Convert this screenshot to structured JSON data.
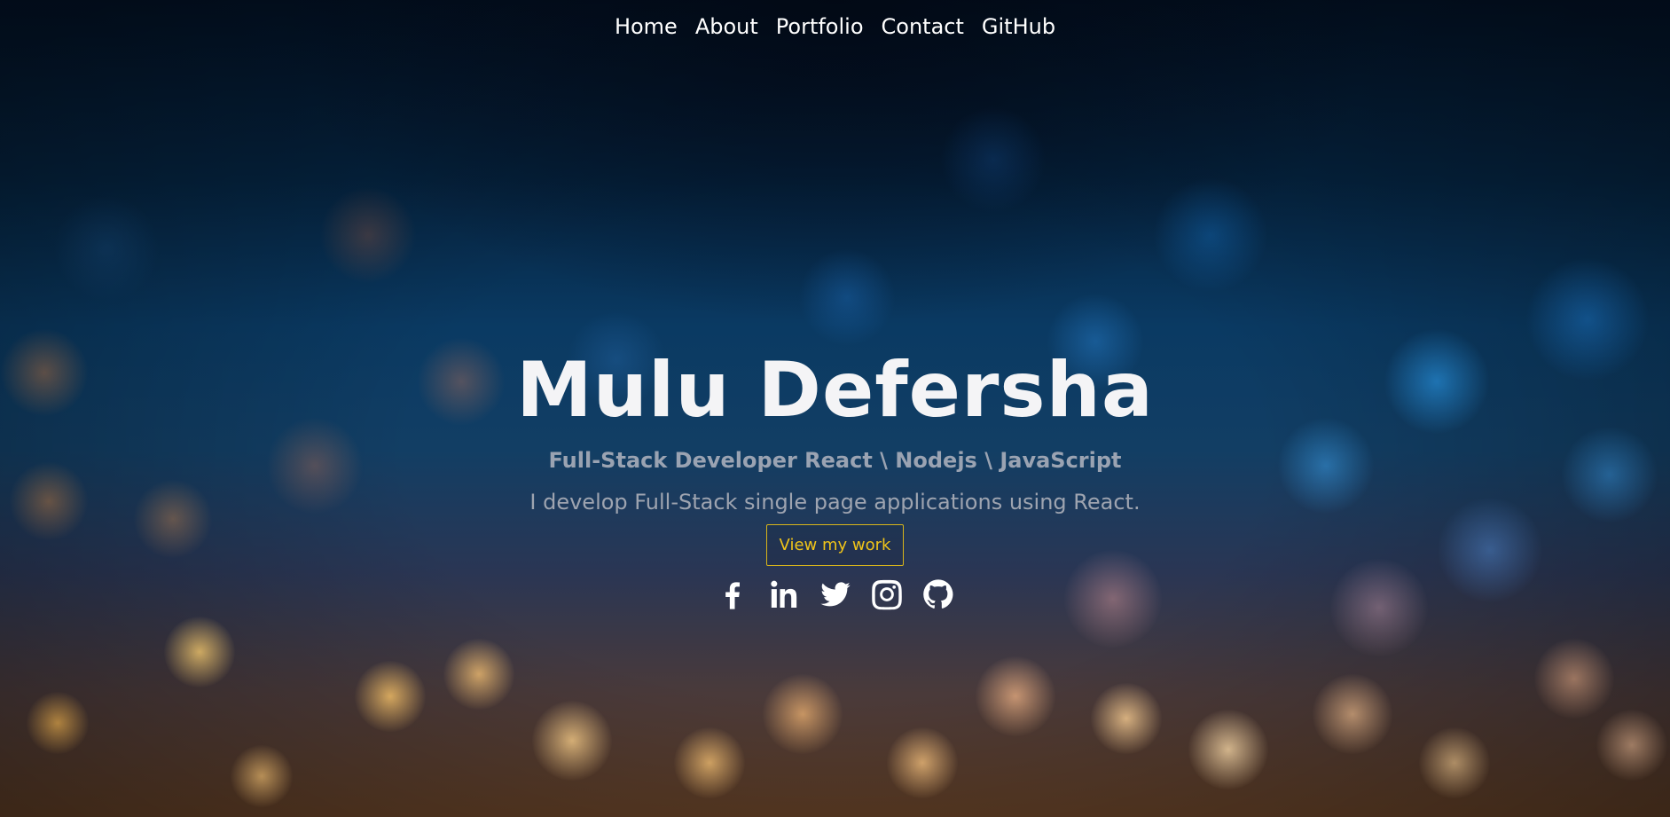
{
  "nav": {
    "items": [
      {
        "label": "Home"
      },
      {
        "label": "About"
      },
      {
        "label": "Portfolio"
      },
      {
        "label": "Contact"
      },
      {
        "label": "GitHub"
      }
    ]
  },
  "hero": {
    "name": "Mulu Defersha",
    "subtitle": "Full-Stack Developer React \\ Nodejs \\ JavaScript",
    "description": "I develop Full-Stack single page applications using React.",
    "cta_label": "View my work"
  },
  "socials": [
    {
      "icon": "facebook-icon"
    },
    {
      "icon": "linkedin-icon"
    },
    {
      "icon": "twitter-icon"
    },
    {
      "icon": "instagram-icon"
    },
    {
      "icon": "github-icon"
    }
  ],
  "colors": {
    "accent": "#f0c419",
    "text": "#ffffff",
    "muted": "#9aa3b2",
    "background_top": "#031226",
    "background_blue": "#0a3a63",
    "background_bottom": "#5a3a22"
  }
}
